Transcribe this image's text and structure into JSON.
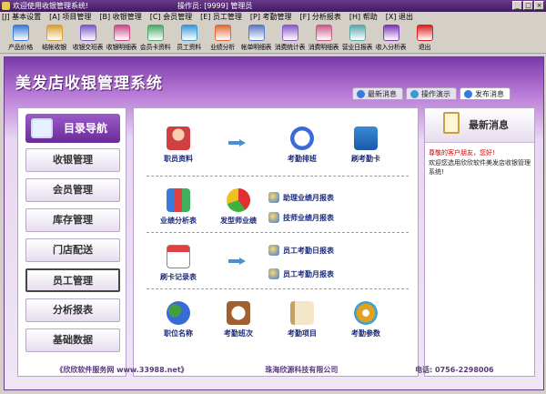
{
  "window": {
    "title": "欢迎使用收银管理系统!",
    "operator": "操作员: [9999] 管理员",
    "controls": [
      "_",
      "□",
      "×"
    ]
  },
  "menu": [
    "[J] 基本设置",
    "[A] 项目管理",
    "[B] 收银管理",
    "[C] 会员管理",
    "[E] 员工管理",
    "[P] 考勤管理",
    "[F] 分析报表",
    "[H] 帮助",
    "[X] 退出"
  ],
  "toolbar": [
    {
      "label": "产品价格",
      "icon": "price-icon",
      "color": "#3a7ad8"
    },
    {
      "label": "结帐收银",
      "icon": "cashier-icon",
      "color": "#d8a030"
    },
    {
      "label": "收银交班表",
      "icon": "handover-icon",
      "color": "#7a5ac8"
    },
    {
      "label": "收银明细表",
      "icon": "detail-icon",
      "color": "#c84a8a"
    },
    {
      "label": "会员卡资料",
      "icon": "card-icon",
      "color": "#4aa86a"
    },
    {
      "label": "员工资料",
      "icon": "staff-icon",
      "color": "#3a9ad8"
    },
    {
      "label": "业绩分析",
      "icon": "performance-icon",
      "color": "#e06a3a"
    },
    {
      "label": "帐单明细表",
      "icon": "bill-icon",
      "color": "#5a7ac8"
    },
    {
      "label": "消费统计表",
      "icon": "stats-icon",
      "color": "#8a5ac8"
    },
    {
      "label": "消费明细表",
      "icon": "consume-icon",
      "color": "#c85a8a"
    },
    {
      "label": "营业日报表",
      "icon": "daily-icon",
      "color": "#5aa8a8"
    },
    {
      "label": "收入分析表",
      "icon": "income-icon",
      "color": "#7a3ab8"
    },
    {
      "label": "退出",
      "icon": "exit-icon",
      "color": "#d82020"
    }
  ],
  "app_title": "美发店收银管理系统",
  "topnav": [
    {
      "label": "最新消息",
      "color": "#3a7ad8"
    },
    {
      "label": "操作演示",
      "color": "#3a9ad8"
    },
    {
      "label": "发布消息",
      "color": "#3a7ad8"
    }
  ],
  "sidebar": {
    "heading": "目录导航",
    "items": [
      "收银管理",
      "会员管理",
      "库存管理",
      "门店配送",
      "员工管理",
      "分析报表",
      "基础数据"
    ]
  },
  "content": {
    "staff_info": "职员资料",
    "attendance_shift": "考勤排班",
    "punch_card": "刷考勤卡",
    "perf_table": "业绩分析表",
    "stylist_perf": "发型师业绩",
    "assistant_month": "助理业绩月报表",
    "tech_month": "技师业绩月报表",
    "card_records": "刷卡记录表",
    "att_daily": "员工考勤日报表",
    "att_monthly": "员工考勤月报表",
    "position": "职位名称",
    "att_shift": "考勤班次",
    "att_item": "考勤项目",
    "att_params": "考勤参数"
  },
  "news": {
    "title": "最新消息",
    "greeting": "尊敬的客户朋友，您好!",
    "text": "欢迎您选用欣欣软件美发店收银管理系统!"
  },
  "footer": {
    "site": "《欣欣软件服务网 www.33988.net》",
    "company": "珠海欣源科技有限公司",
    "phone": "电话: 0756-2298006"
  }
}
